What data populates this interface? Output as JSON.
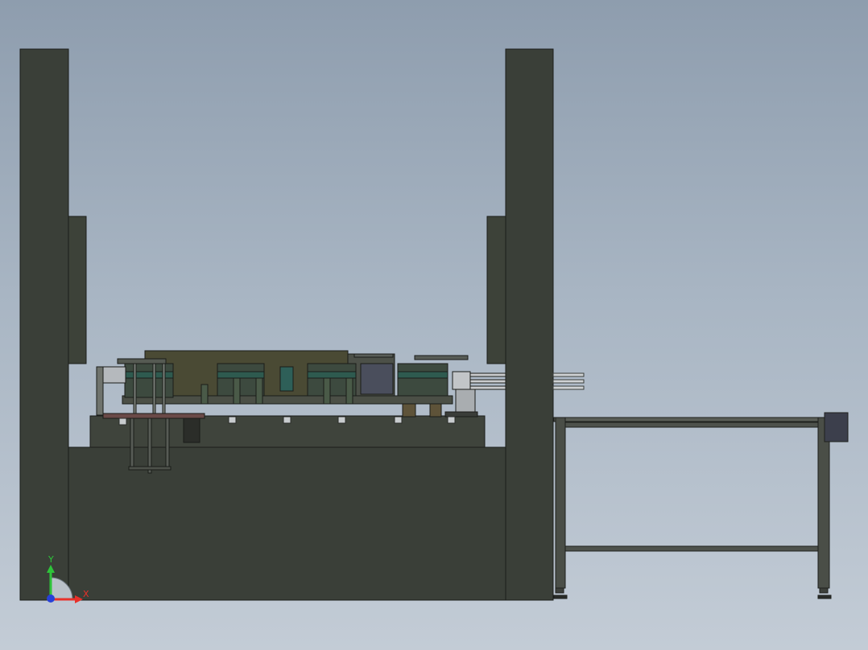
{
  "view": {
    "background_top": "#8e9dae",
    "background_bottom": "#c3ccd6",
    "model_color": "#3a3f38",
    "edge_color": "#1b1d1a"
  },
  "triad": {
    "x_label": "X",
    "y_label": "Y",
    "x_color": "#e8302a",
    "y_color": "#2ec43a",
    "z_color": "#2740d8"
  }
}
